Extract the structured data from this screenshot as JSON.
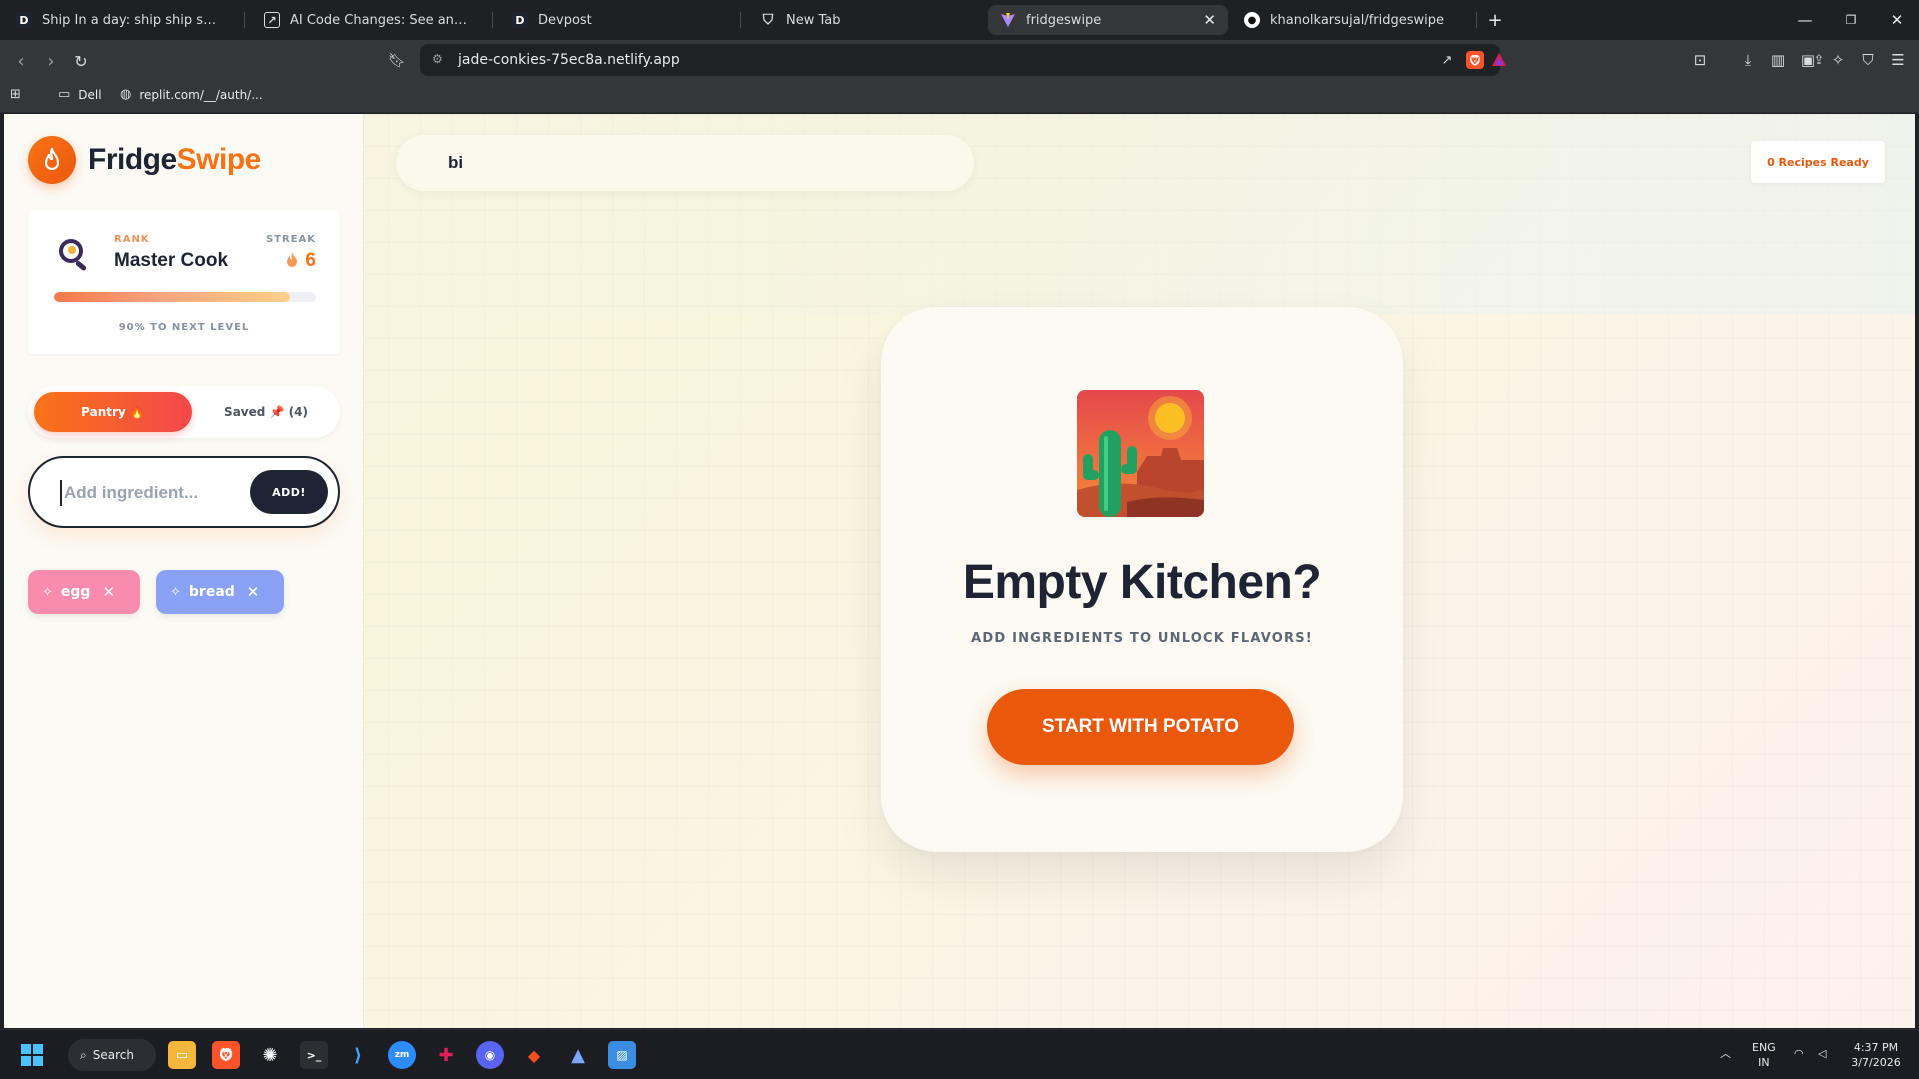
{
  "browser": {
    "tabs": [
      {
        "title": "Ship In a day: ship ship ship - Devpos",
        "icon": "devpost-favicon"
      },
      {
        "title": "AI Code Changes: See and Apply | Go",
        "icon": "external-favicon"
      },
      {
        "title": "Devpost",
        "icon": "devpost-favicon"
      },
      {
        "title": "New Tab",
        "icon": "brave-shield-favicon"
      },
      {
        "title": "fridgeswipe",
        "icon": "vite-favicon",
        "active": true
      },
      {
        "title": "khanolkarsujal/fridgeswipe",
        "icon": "github-favicon"
      }
    ],
    "url": "jade-conkies-75ec8a.netlify.app",
    "bookmarks": [
      {
        "label": "Dell",
        "icon": "folder-icon"
      },
      {
        "label": "replit.com/__/auth/...",
        "icon": "globe-icon"
      }
    ]
  },
  "app": {
    "brand": {
      "part1": "Fridge",
      "part2": "Swipe",
      "accent": "#f97316"
    },
    "rank": {
      "rank_label": "RANK",
      "rank_value": "Master Cook",
      "streak_label": "STREAK",
      "streak_value": "6",
      "progress_fraction": 0.9,
      "progress_text": "90% TO NEXT LEVEL"
    },
    "toggle": {
      "pantry": "Pantry 🔥",
      "saved": "Saved 📌 (4)"
    },
    "add": {
      "placeholder": "Add ingredient...",
      "value": "",
      "button": "ADD!"
    },
    "chips": [
      {
        "label": "egg",
        "color": "#f98cae"
      },
      {
        "label": "bread",
        "color": "#8aa2f6"
      }
    ],
    "search": {
      "value": "bi"
    },
    "ready_badge": "0 Recipes Ready",
    "empty": {
      "title": "Empty Kitchen?",
      "subtitle": "ADD INGREDIENTS TO UNLOCK FLAVORS!",
      "cta": "START WITH POTATO"
    }
  },
  "taskbar": {
    "search_label": "Search",
    "lang": "ENG",
    "region": "IN",
    "time": "4:37 PM",
    "date": "3/7/2026"
  }
}
